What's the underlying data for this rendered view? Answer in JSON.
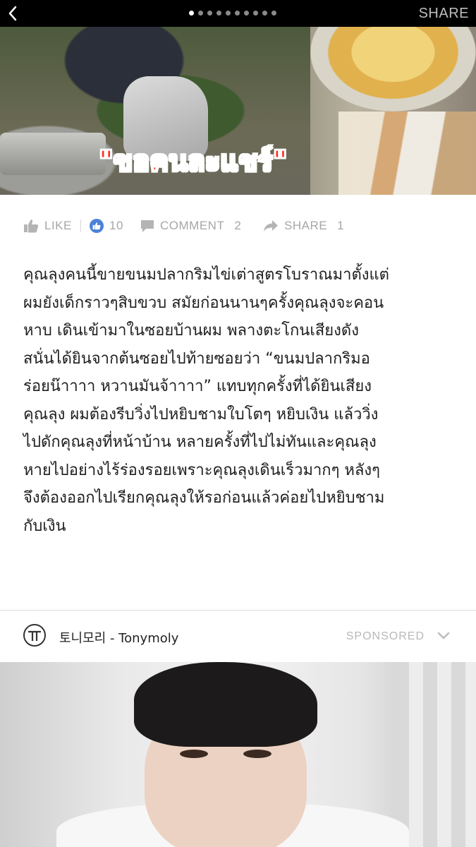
{
  "topbar": {
    "share_label": "SHARE",
    "page_dots_total": 10,
    "page_dots_active_index": 0
  },
  "hero": {
    "caption": "\"ขอคนละแชร์\""
  },
  "social": {
    "like_label": "LIKE",
    "like_count": "10",
    "comment_label": "COMMENT",
    "comment_count": "2",
    "share_label": "SHARE",
    "share_count": "1",
    "accent_color": "#4a82d8"
  },
  "article": {
    "lines": [
      "คุณลุงคนนี้ขายขนมปลากริมไข่เต่าสูตรโบราณมาตั้งแต่",
      "ผมยังเด็กราวๆสิบขวบ สมัยก่อนนานๆครั้งคุณลุงจะคอน",
      "หาบ เดินเข้ามาในซอยบ้านผม พลางตะโกนเสียงดัง",
      "สนั่นได้ยินจากต้นซอยไปท้ายซอยว่า “ขนมปลากริมอ",
      "ร่อยน๊าาาา หวานมันจ้าาาา” แทบทุกครั้งที่ได้ยินเสียง",
      "คุณลุง ผมต้องรีบวิ่งไปหยิบชามใบโตๆ หยิบเงิน แล้ววิ่ง",
      "ไปดักคุณลุงที่หน้าบ้าน หลายครั้งที่ไปไม่ทันและคุณลุง",
      "หายไปอย่างไร้ร่องรอยเพราะคุณลุงเดินเร็วมากๆ หลังๆ",
      "จึงต้องออกไปเรียกคุณลุงให้รอก่อนแล้วค่อยไปหยิบชาม",
      "กับเงิน"
    ]
  },
  "sponsor": {
    "brand": "토니모리 - Tonymoly",
    "tag": "SPONSORED"
  },
  "icons": {
    "back": "chevron-left-icon",
    "like": "thumbs-up-icon",
    "comment": "speech-bubble-icon",
    "share": "share-arrow-icon",
    "menu": "chevron-down-icon"
  }
}
